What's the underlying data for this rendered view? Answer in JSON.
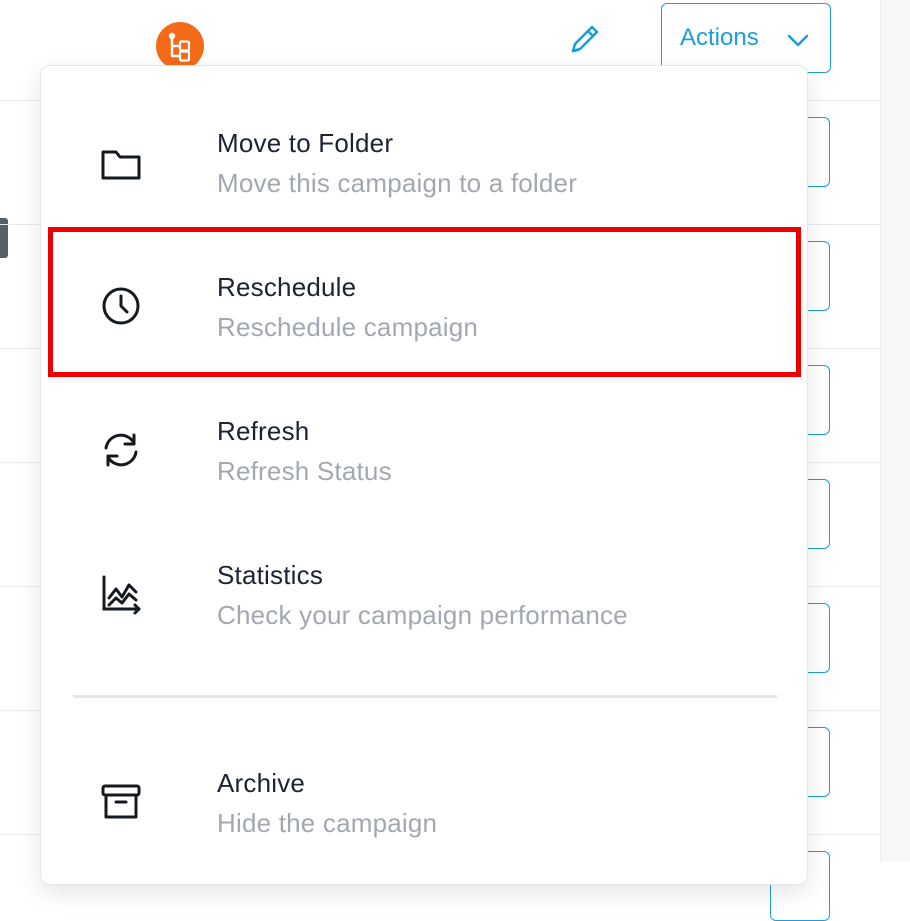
{
  "header": {
    "actions_label": "Actions"
  },
  "icons": {
    "flow_badge": "workflow-icon",
    "edit": "pencil-icon",
    "chevron": "chevron-down-icon"
  },
  "colors": {
    "accent": "#1a9fdc",
    "badge": "#f46a18",
    "highlight": "#ee0000",
    "title_text": "#1d2330",
    "desc_text": "#a2a8b2"
  },
  "menu": {
    "items": [
      {
        "title": "Move to Folder",
        "description": "Move this campaign to a folder",
        "icon": "folder-icon"
      },
      {
        "title": "Reschedule",
        "description": "Reschedule campaign",
        "icon": "clock-icon"
      },
      {
        "title": "Refresh",
        "description": "Refresh Status",
        "icon": "refresh-icon"
      },
      {
        "title": "Statistics",
        "description": "Check your campaign performance",
        "icon": "statistics-icon"
      },
      {
        "title": "Archive",
        "description": "Hide the campaign",
        "icon": "archive-icon"
      }
    ]
  }
}
